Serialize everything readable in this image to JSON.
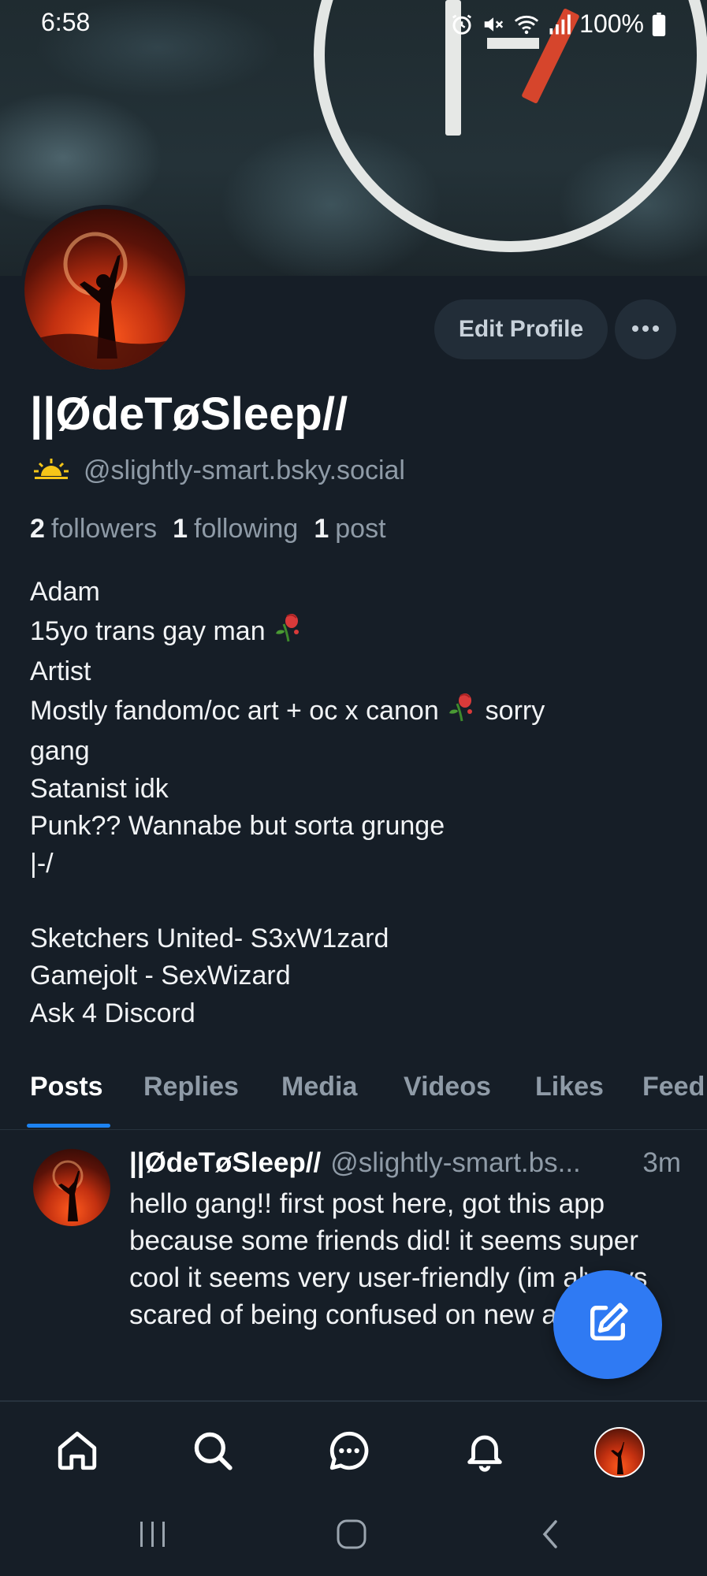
{
  "status_bar": {
    "time": "6:58",
    "battery": "100%",
    "icons": [
      "alarm-icon",
      "mute-icon",
      "wifi-icon",
      "signal-icon",
      "battery-icon"
    ]
  },
  "profile": {
    "display_name": "||ØdeTøSleep//",
    "handle": "@slightly-smart.bsky.social",
    "handle_icon": "sun-icon",
    "edit_button": "Edit Profile",
    "more_button": "more-icon",
    "stats": {
      "followers_count": "2",
      "followers_label": "followers",
      "following_count": "1",
      "following_label": "following",
      "posts_count": "1",
      "posts_label": "post"
    },
    "bio": {
      "line1": "Adam",
      "line2": "15yo trans gay man",
      "line3": "Artist",
      "line4a": "Mostly fandom/oc art + oc x canon",
      "line4b": "sorry",
      "line5": "gang",
      "line6": "Satanist idk",
      "line7": "Punk?? Wannabe but sorta grunge",
      "line8": "|-/",
      "line9": "",
      "line10": "Sketchers United- S3xW1zard",
      "line11": "Gamejolt - SexWizard",
      "line12": "Ask 4 Discord"
    }
  },
  "tabs": {
    "posts": "Posts",
    "replies": "Replies",
    "media": "Media",
    "videos": "Videos",
    "likes": "Likes",
    "feeds": "Feed",
    "active": "Posts"
  },
  "post": {
    "author": "||ØdeTøSleep//",
    "handle": "@slightly-smart.bs...",
    "time": "3m",
    "text": "hello gang!! first post here, got this app because some friends did! it seems super cool it seems very user-friendly (im always scared of being confused on new apps)"
  },
  "bottom_nav": [
    "home-icon",
    "search-icon",
    "chat-icon",
    "notifications-icon",
    "profile-avatar"
  ],
  "system_nav": [
    "recents-icon",
    "home-circle-icon",
    "back-icon"
  ],
  "colors": {
    "background": "#161e27",
    "accent": "#1d83f2",
    "fab": "#2f7af3",
    "muted_text": "#8f9ba7"
  }
}
